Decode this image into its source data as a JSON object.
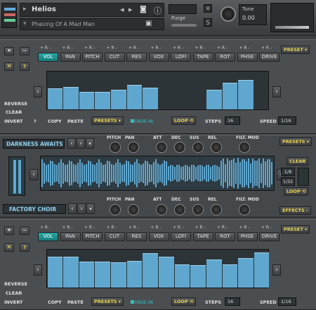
{
  "header": {
    "instrument_name": "Helios",
    "preset_name": "Phasing Of A Mad Man",
    "purge_label": "Purge",
    "tune_label": "Tune",
    "tune_value": "0.00"
  },
  "fx_tabs": [
    "VOL",
    "PAN",
    "PITCH",
    "CUT",
    "RES",
    "VOX",
    "LOFI",
    "TAPE",
    "ROT",
    "PHSE",
    "DRIVE"
  ],
  "fx_tab_pm": "+ R -",
  "top": {
    "active_tab": "VOL",
    "preset_label": "PRESET",
    "values": [
      0.55,
      0.6,
      0.46,
      0.46,
      0.52,
      0.64,
      0.58,
      0.0,
      0.0,
      0.0,
      0.52,
      0.7,
      0.78,
      0.0
    ],
    "reverse_label": "REVERSE",
    "clear_label": "CLEAR",
    "invert_label": "INVERT",
    "question": "?",
    "copy_label": "COPY",
    "paste_label": "PASTE",
    "presets_label": "PRESETS",
    "fadein_label": "FADE-IN",
    "loop_label": "LOOP",
    "steps_label": "STEPS",
    "steps_value": "16",
    "speed_label": "SPEED",
    "speed_value": "1/16"
  },
  "mid": {
    "title": "DARKNESS AWAITS",
    "subtitle": "FACTORY CHOIR",
    "knob_labels": [
      "PITCH",
      "PAN",
      "ATT",
      "DEC",
      "SUS",
      "REL",
      "FILT. MOD"
    ],
    "presets_label": "PRESETS",
    "clear_label": "CLEAR",
    "rate_a": "1/8",
    "rate_b": "1/32",
    "loop_label": "LOOP",
    "effects_label": "EFFECTS"
  },
  "bottom": {
    "active_tab": "VOL",
    "preset_label": "PRESET",
    "values": [
      0.82,
      0.82,
      0.68,
      0.68,
      0.66,
      0.7,
      0.9,
      0.82,
      0.62,
      0.6,
      0.75,
      0.62,
      0.78,
      0.92
    ],
    "reverse_label": "REVERSE",
    "clear_label": "CLEAR",
    "invert_label": "INVERT",
    "copy_label": "COPY",
    "paste_label": "PASTE",
    "presets_label": "PRESETS",
    "fadein_label": "FADE-IN",
    "loop_label": "LOOP",
    "steps_label": "STEPS",
    "steps_value": "16",
    "speed_label": "SPEED",
    "speed_value": "1/16"
  },
  "icons": {
    "link": "link-icon",
    "close": "close-icon",
    "add": "plus-icon",
    "help": "question-icon"
  },
  "colors": {
    "accent": "#27a9a6",
    "bar": "#5fa7cf",
    "highlight": "#e8d34a",
    "background": "#3d3f41"
  }
}
